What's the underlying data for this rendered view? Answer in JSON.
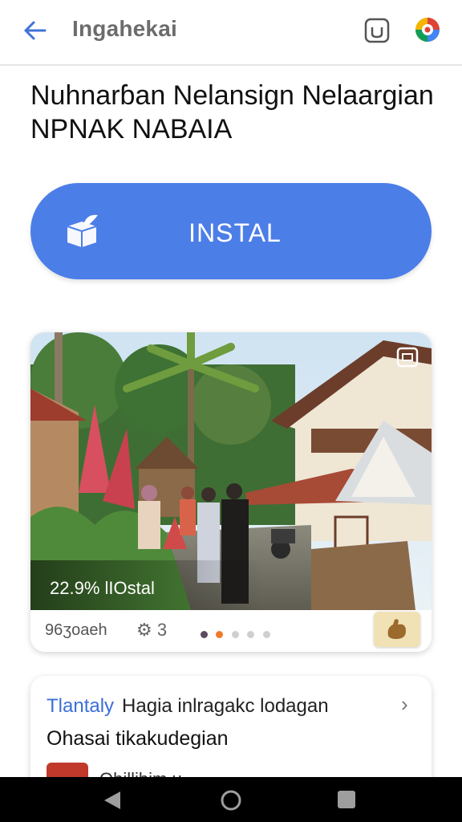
{
  "topbar": {
    "title": "Ingahekai"
  },
  "headline": {
    "line1": "Nuhnarɓan Nelansign Nelaargian",
    "line2": "NPNAK NABAIA"
  },
  "install_button": {
    "label": "INSTAL",
    "color": "#4c7ee8"
  },
  "media_card": {
    "stats": "22.9%  lIOstal",
    "footer_left": "96ʒoaeh",
    "footer_gear_text": "3",
    "dots_count": 5,
    "active_dot": 1
  },
  "info_card": {
    "category": "Tlantaly",
    "description": "Hagia inlragakc lodagan",
    "title": "Ohasai tikakudegian",
    "subtitle": "Ohillibim u"
  },
  "colors": {
    "accent": "#4c7ee8",
    "category_text": "#3a6fd8"
  },
  "icons": {
    "back": "arrow-left-icon",
    "top1": "camera-icon",
    "top2": "google-assistant-icon",
    "install": "package-icon",
    "photo_corner": "gallery-icon",
    "footer_badge": "hand-icon",
    "chevron": "chevron-right-icon"
  }
}
